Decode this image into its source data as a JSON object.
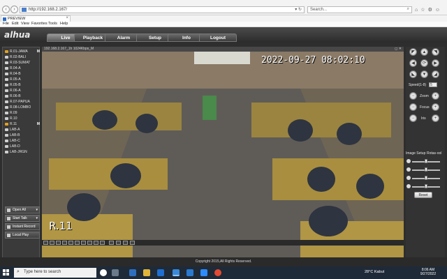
{
  "browser": {
    "url": "http://192.168.2.167/",
    "search_placeholder": "Search...",
    "tab_title": "PREVIEW",
    "menu": [
      "File",
      "Edit",
      "View",
      "Favorites",
      "Tools",
      "Help"
    ]
  },
  "app": {
    "logo": "alhua",
    "tabs": [
      "Live",
      "Playback",
      "Alarm",
      "Setup",
      "Info",
      "Logout"
    ],
    "channels": [
      {
        "label": "R.01-JAWA",
        "active": true,
        "marker": "M"
      },
      {
        "label": "R.02-BALI"
      },
      {
        "label": "R.03-SUMAT"
      },
      {
        "label": "R.04-A"
      },
      {
        "label": "R.04-B"
      },
      {
        "label": "R.05-A"
      },
      {
        "label": "R.05-B"
      },
      {
        "label": "R.06-A"
      },
      {
        "label": "R.06-B"
      },
      {
        "label": "R.07-PAPUA"
      },
      {
        "label": "R.08-LOMBO"
      },
      {
        "label": "R.09"
      },
      {
        "label": "R.10"
      },
      {
        "label": "R.11",
        "active": true,
        "marker": "M"
      },
      {
        "label": "LAB-A"
      },
      {
        "label": "LAB-B"
      },
      {
        "label": "LAB-C"
      },
      {
        "label": "LAB-D"
      },
      {
        "label": "LAB-JRGN"
      }
    ],
    "controls": [
      "Open All",
      "Start Talk",
      "Instant Record",
      "Local Play"
    ],
    "video": {
      "header": "192.168.2.167_1h 1024Kbps_M",
      "timestamp": "2022-09-27 08:02:10",
      "camera_label": "R.11"
    },
    "ptz": {
      "speed_label": "Speed(1-8)",
      "speed_value": "5",
      "zoom": "Zoom",
      "focus": "Focus",
      "iris": "Iris",
      "image_setup": "Image Setup",
      "rotate_tab": "Rotas-ool",
      "reset": "Reset"
    },
    "footer": "Copyright 2015,All Rights Reserved."
  },
  "taskbar": {
    "search_placeholder": "Type here to search",
    "weather": "28°C  Kabut",
    "time": "8:06 AM",
    "date": "9/27/2022"
  }
}
